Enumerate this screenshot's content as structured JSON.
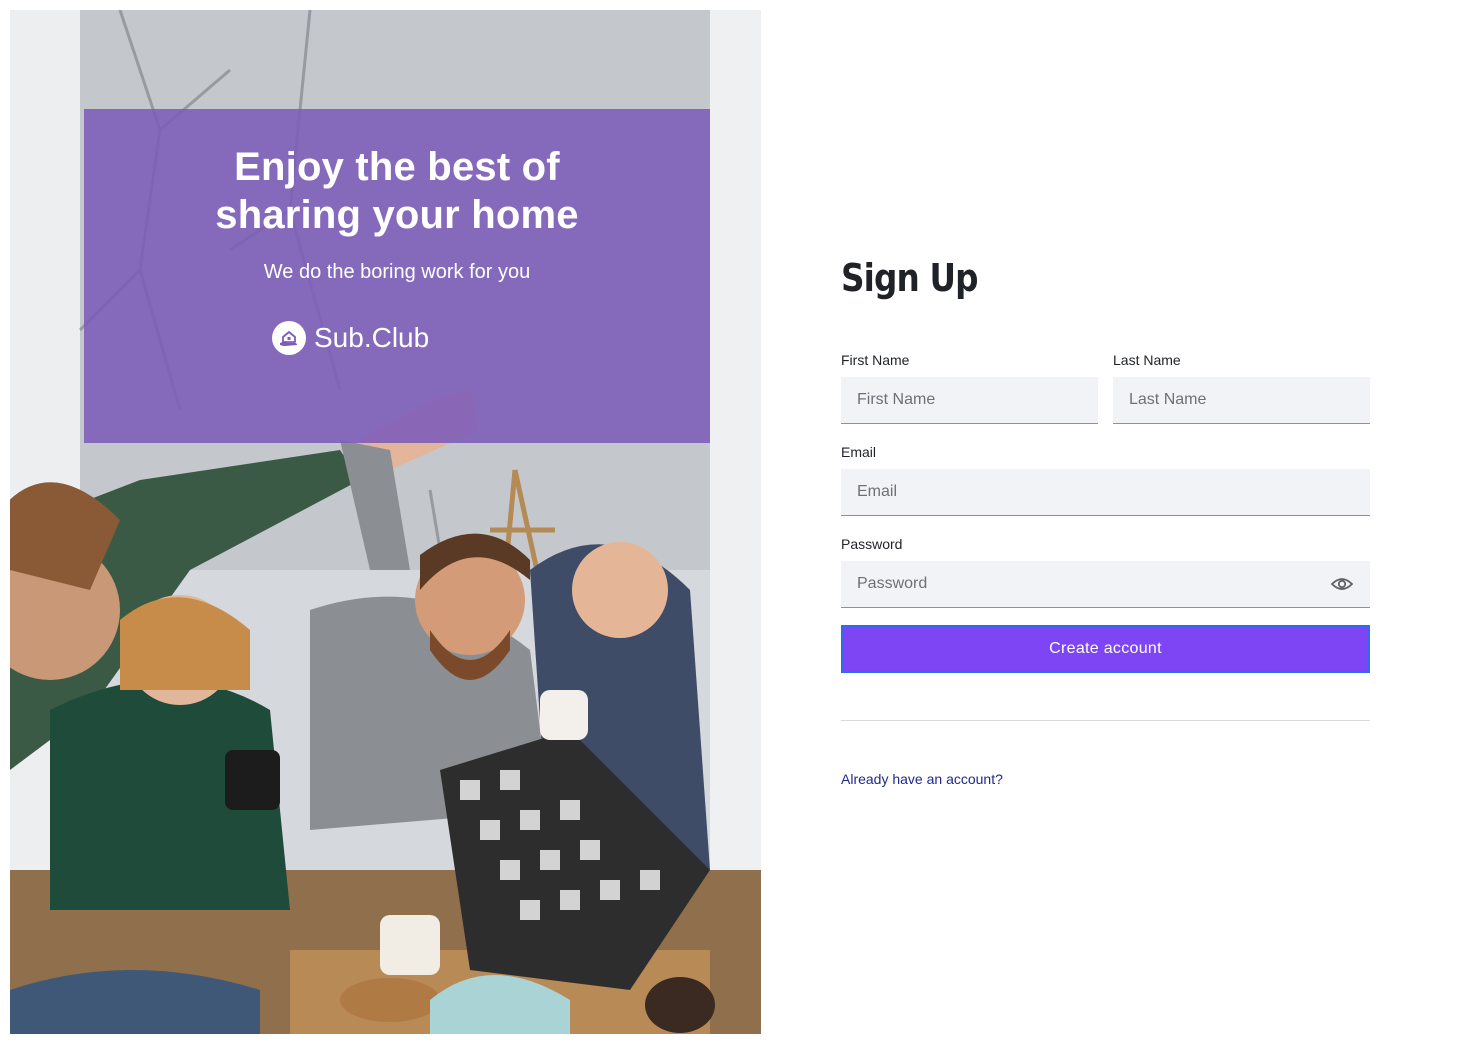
{
  "hero": {
    "headline_line1": "Enjoy the best of",
    "headline_line2": "sharing your home",
    "tagline": "We do the boring work for you",
    "brand_name": "Sub.Club",
    "brand_icon": "house-in-hand-icon",
    "overlay_color": "#7c5cba"
  },
  "form": {
    "title": "Sign Up",
    "first_name": {
      "label": "First Name",
      "placeholder": "First Name",
      "value": ""
    },
    "last_name": {
      "label": "Last Name",
      "placeholder": "Last Name",
      "value": ""
    },
    "email": {
      "label": "Email",
      "placeholder": "Email",
      "value": ""
    },
    "password": {
      "label": "Password",
      "placeholder": "Password",
      "value": "",
      "toggle_icon": "eye-icon"
    },
    "submit_label": "Create account",
    "submit_color": "#7e45f5",
    "login_link": "Already have an account?"
  }
}
